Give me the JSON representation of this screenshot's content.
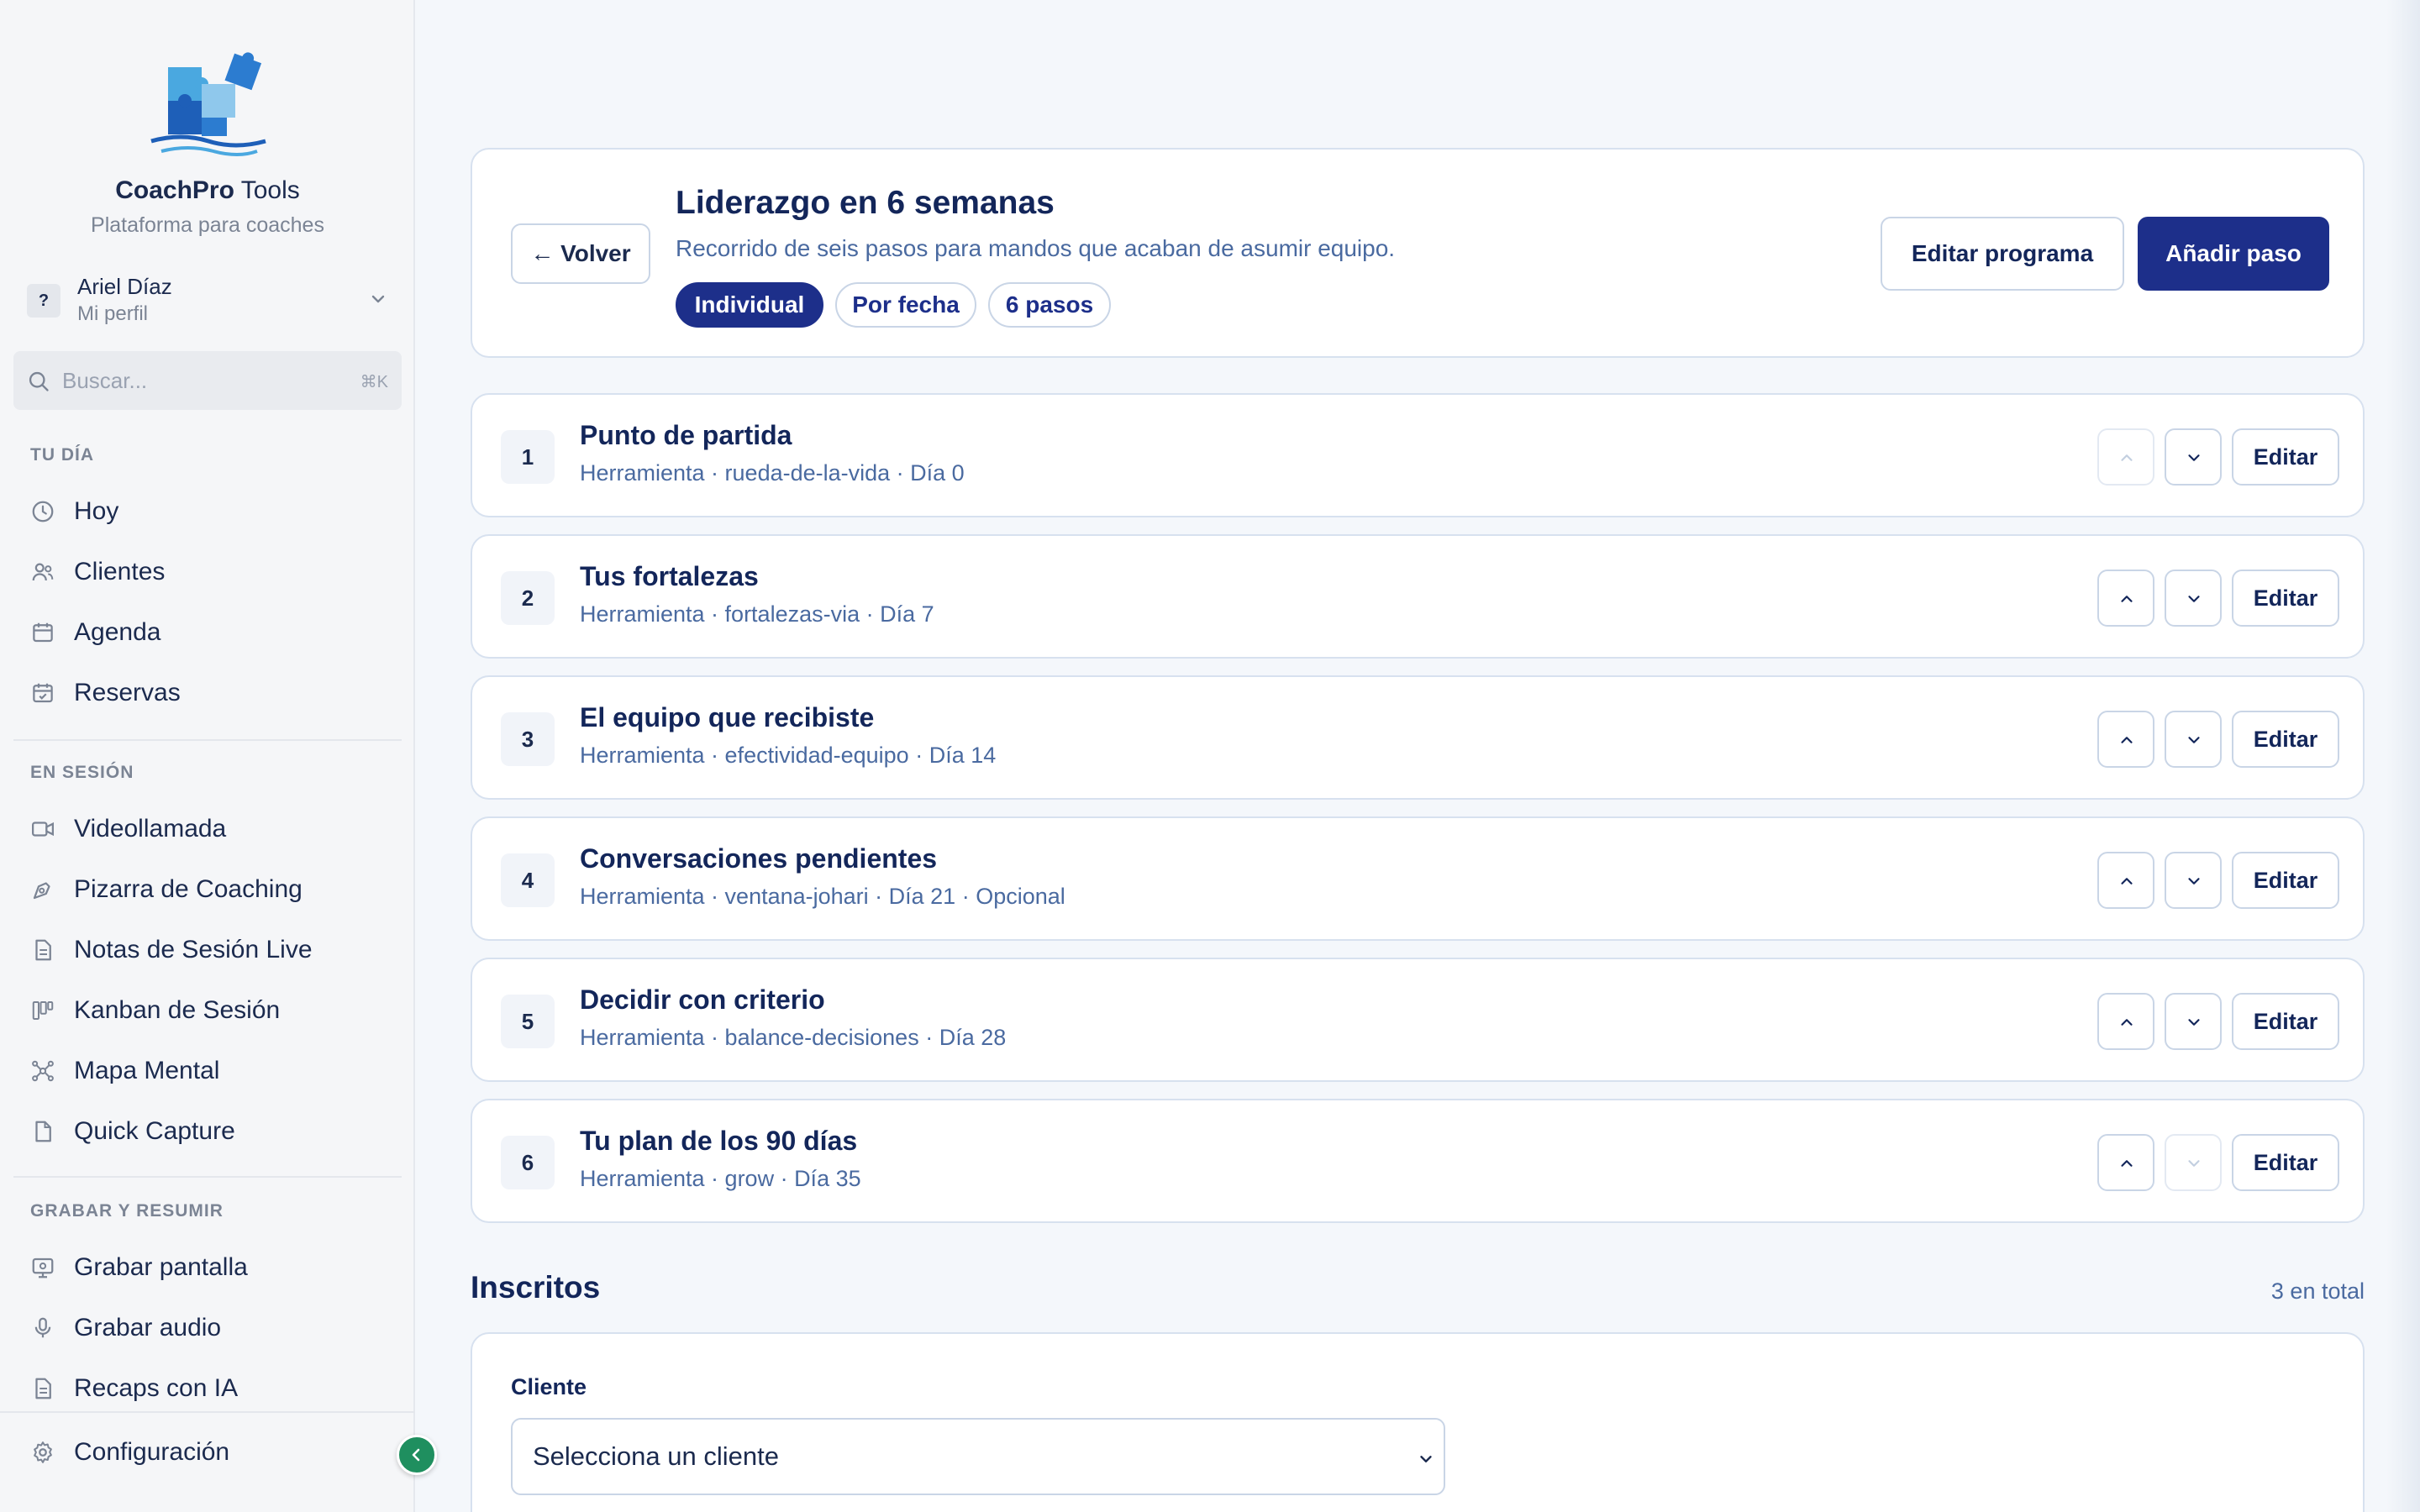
{
  "brand": {
    "name_bold": "CoachPro",
    "name_rest": " Tools",
    "subtitle": "Plataforma para coaches"
  },
  "profile": {
    "initial": "?",
    "name": "Ariel Díaz",
    "sub": "Mi perfil"
  },
  "search": {
    "placeholder": "Buscar...",
    "shortcut": "⌘K"
  },
  "sidebar": {
    "sections": [
      {
        "title": "TU DÍA",
        "items": [
          "Hoy",
          "Clientes",
          "Agenda",
          "Reservas"
        ]
      },
      {
        "title": "EN SESIÓN",
        "items": [
          "Videollamada",
          "Pizarra de Coaching",
          "Notas de Sesión Live",
          "Kanban de Sesión",
          "Mapa Mental",
          "Quick Capture"
        ]
      },
      {
        "title": "GRABAR Y RESUMIR",
        "items": [
          "Grabar pantalla",
          "Grabar audio",
          "Recaps con IA"
        ]
      }
    ],
    "footer": "Configuración"
  },
  "program": {
    "back_label": "← Volver",
    "title": "Liderazgo en 6 semanas",
    "description": "Recorrido de seis pasos para mandos que acaban de asumir equipo.",
    "chips": [
      "Individual",
      "Por fecha",
      "6 pasos"
    ],
    "edit_label": "Editar programa",
    "add_label": "Añadir paso"
  },
  "steps": [
    {
      "num": "1",
      "title": "Punto de partida",
      "meta": "Herramienta · rueda-de-la-vida · Día 0"
    },
    {
      "num": "2",
      "title": "Tus fortalezas",
      "meta": "Herramienta · fortalezas-via · Día 7"
    },
    {
      "num": "3",
      "title": "El equipo que recibiste",
      "meta": "Herramienta · efectividad-equipo · Día 14"
    },
    {
      "num": "4",
      "title": "Conversaciones pendientes",
      "meta": "Herramienta · ventana-johari · Día 21 · Opcional"
    },
    {
      "num": "5",
      "title": "Decidir con criterio",
      "meta": "Herramienta · balance-decisiones · Día 28"
    },
    {
      "num": "6",
      "title": "Tu plan de los 90 días",
      "meta": "Herramienta · grow · Día 35"
    }
  ],
  "step_edit_label": "Editar",
  "enrolled": {
    "title": "Inscritos",
    "count": "3 en total",
    "field_label": "Cliente",
    "select_value": "Selecciona un cliente"
  },
  "colors": {
    "primary": "#1d2f8a",
    "accent_green": "#1f8f5f",
    "muted_text": "#4a6aa0"
  }
}
